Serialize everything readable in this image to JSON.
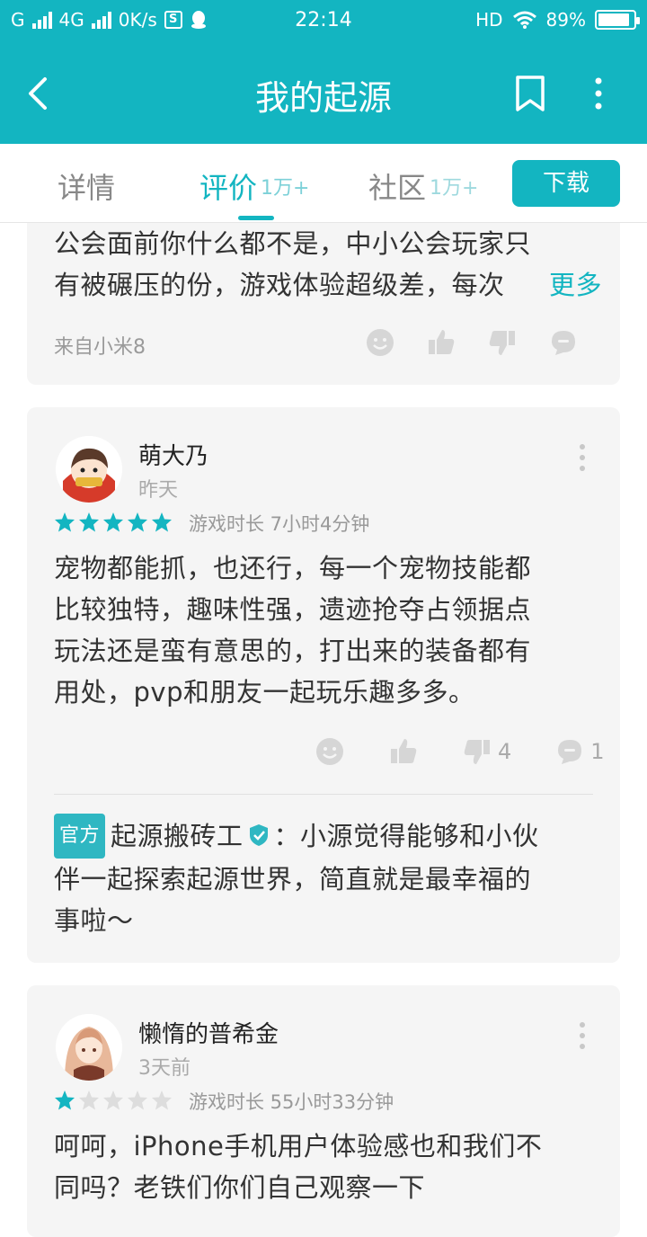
{
  "status_bar": {
    "carrier1": "G",
    "network": "4G",
    "speed": "0K/s",
    "app_badge": "S",
    "time": "22:14",
    "hd": "HD",
    "battery_pct": "89%",
    "battery_level": 0.89
  },
  "app_bar": {
    "title": "我的起源"
  },
  "tabs": [
    {
      "label": "详情",
      "count": ""
    },
    {
      "label": "评价",
      "count": "1万+"
    },
    {
      "label": "社区",
      "count": "1万+"
    }
  ],
  "download_label": "下载",
  "review0": {
    "text_line1": "公会面前你什么都不是，中小公会玩家只",
    "text_line2": "有被碾压的份，游戏体验超级差，每次",
    "more": "更多",
    "device": "来自小米8"
  },
  "review1": {
    "username": "萌大乃",
    "time": "昨天",
    "rating": 5,
    "playtime": "游戏时长 7小时4分钟",
    "text": [
      "宠物都能抓，也还行，每一个宠物技能都",
      "比较独特，趣味性强，遗迹抢夺占领据点",
      "玩法还是蛮有意思的，打出来的装备都有",
      "用处，pvp和朋友一起玩乐趣多多。"
    ],
    "dislike_count": "4",
    "comment_count": "1",
    "reply": {
      "badge": "官方",
      "author": "起源搬砖工",
      "line1": "：小源觉得能够和小伙",
      "line2": "伴一起探索起源世界，简直就是最幸福的",
      "line3": "事啦～"
    }
  },
  "review2": {
    "username": "懒惰的普希金",
    "time": "3天前",
    "rating": 1,
    "playtime": "游戏时长 55小时33分钟",
    "text": [
      "呵呵，iPhone手机用户体验感也和我们不",
      "同吗？老铁们你们自己观察一下"
    ]
  },
  "colors": {
    "accent": "#13b5c1",
    "star_on": "#13b5c1",
    "star_off": "#dddddd"
  }
}
